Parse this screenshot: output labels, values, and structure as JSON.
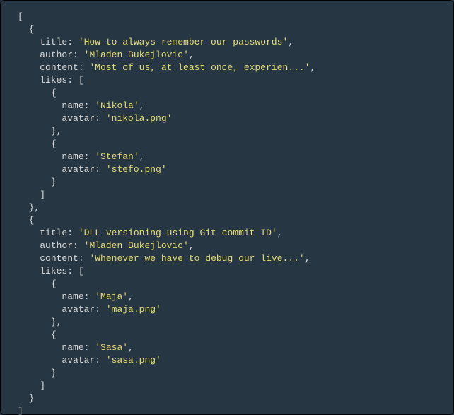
{
  "code_block": {
    "lines": [
      {
        "indent": 0,
        "segments": [
          {
            "cls": "p",
            "text": "["
          }
        ]
      },
      {
        "indent": 1,
        "segments": [
          {
            "cls": "p",
            "text": "{"
          }
        ]
      },
      {
        "indent": 2,
        "segments": [
          {
            "cls": "k",
            "text": "title: "
          },
          {
            "cls": "s",
            "text": "'How to always remember our passwords'"
          },
          {
            "cls": "p",
            "text": ","
          }
        ]
      },
      {
        "indent": 2,
        "segments": [
          {
            "cls": "k",
            "text": "author: "
          },
          {
            "cls": "s",
            "text": "'Mladen Bukejlovic'"
          },
          {
            "cls": "p",
            "text": ","
          }
        ]
      },
      {
        "indent": 2,
        "segments": [
          {
            "cls": "k",
            "text": "content: "
          },
          {
            "cls": "s",
            "text": "'Most of us, at least once, experien...'"
          },
          {
            "cls": "p",
            "text": ","
          }
        ]
      },
      {
        "indent": 2,
        "segments": [
          {
            "cls": "k",
            "text": "likes: "
          },
          {
            "cls": "p",
            "text": "["
          }
        ]
      },
      {
        "indent": 3,
        "segments": [
          {
            "cls": "p",
            "text": "{"
          }
        ]
      },
      {
        "indent": 4,
        "segments": [
          {
            "cls": "k",
            "text": "name: "
          },
          {
            "cls": "s",
            "text": "'Nikola'"
          },
          {
            "cls": "p",
            "text": ","
          }
        ]
      },
      {
        "indent": 4,
        "segments": [
          {
            "cls": "k",
            "text": "avatar: "
          },
          {
            "cls": "s",
            "text": "'nikola.png'"
          }
        ]
      },
      {
        "indent": 3,
        "segments": [
          {
            "cls": "p",
            "text": "},"
          }
        ]
      },
      {
        "indent": 3,
        "segments": [
          {
            "cls": "p",
            "text": "{"
          }
        ]
      },
      {
        "indent": 4,
        "segments": [
          {
            "cls": "k",
            "text": "name: "
          },
          {
            "cls": "s",
            "text": "'Stefan'"
          },
          {
            "cls": "p",
            "text": ","
          }
        ]
      },
      {
        "indent": 4,
        "segments": [
          {
            "cls": "k",
            "text": "avatar: "
          },
          {
            "cls": "s",
            "text": "'stefo.png'"
          }
        ]
      },
      {
        "indent": 3,
        "segments": [
          {
            "cls": "p",
            "text": "}"
          }
        ]
      },
      {
        "indent": 2,
        "segments": [
          {
            "cls": "p",
            "text": "]"
          }
        ]
      },
      {
        "indent": 1,
        "segments": [
          {
            "cls": "p",
            "text": "},"
          }
        ]
      },
      {
        "indent": 1,
        "segments": [
          {
            "cls": "p",
            "text": "{"
          }
        ]
      },
      {
        "indent": 2,
        "segments": [
          {
            "cls": "k",
            "text": "title: "
          },
          {
            "cls": "s",
            "text": "'DLL versioning using Git commit ID'"
          },
          {
            "cls": "p",
            "text": ","
          }
        ]
      },
      {
        "indent": 2,
        "segments": [
          {
            "cls": "k",
            "text": "author: "
          },
          {
            "cls": "s",
            "text": "'Mladen Bukejlovic'"
          },
          {
            "cls": "p",
            "text": ","
          }
        ]
      },
      {
        "indent": 2,
        "segments": [
          {
            "cls": "k",
            "text": "content: "
          },
          {
            "cls": "s",
            "text": "'Whenever we have to debug our live...'"
          },
          {
            "cls": "p",
            "text": ","
          }
        ]
      },
      {
        "indent": 2,
        "segments": [
          {
            "cls": "k",
            "text": "likes: "
          },
          {
            "cls": "p",
            "text": "["
          }
        ]
      },
      {
        "indent": 3,
        "segments": [
          {
            "cls": "p",
            "text": "{"
          }
        ]
      },
      {
        "indent": 4,
        "segments": [
          {
            "cls": "k",
            "text": "name: "
          },
          {
            "cls": "s",
            "text": "'Maja'"
          },
          {
            "cls": "p",
            "text": ","
          }
        ]
      },
      {
        "indent": 4,
        "segments": [
          {
            "cls": "k",
            "text": "avatar: "
          },
          {
            "cls": "s",
            "text": "'maja.png'"
          }
        ]
      },
      {
        "indent": 3,
        "segments": [
          {
            "cls": "p",
            "text": "},"
          }
        ]
      },
      {
        "indent": 3,
        "segments": [
          {
            "cls": "p",
            "text": "{"
          }
        ]
      },
      {
        "indent": 4,
        "segments": [
          {
            "cls": "k",
            "text": "name: "
          },
          {
            "cls": "s",
            "text": "'Sasa'"
          },
          {
            "cls": "p",
            "text": ","
          }
        ]
      },
      {
        "indent": 4,
        "segments": [
          {
            "cls": "k",
            "text": "avatar: "
          },
          {
            "cls": "s",
            "text": "'sasa.png'"
          }
        ]
      },
      {
        "indent": 3,
        "segments": [
          {
            "cls": "p",
            "text": "}"
          }
        ]
      },
      {
        "indent": 2,
        "segments": [
          {
            "cls": "p",
            "text": "]"
          }
        ]
      },
      {
        "indent": 1,
        "segments": [
          {
            "cls": "p",
            "text": "}"
          }
        ]
      },
      {
        "indent": 0,
        "segments": [
          {
            "cls": "p",
            "text": "]"
          }
        ]
      }
    ],
    "indent_unit": "  "
  }
}
